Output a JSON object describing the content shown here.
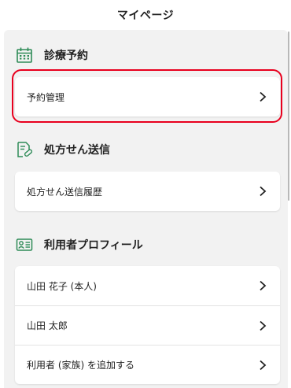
{
  "header": {
    "title": "マイページ"
  },
  "sections": [
    {
      "title": "診療予約",
      "icon": "calendar-icon",
      "items": [
        {
          "label": "予約管理"
        }
      ]
    },
    {
      "title": "処方せん送信",
      "icon": "prescription-icon",
      "items": [
        {
          "label": "処方せん送信履歴"
        }
      ]
    },
    {
      "title": "利用者プロフィール",
      "icon": "profile-card-icon",
      "items": [
        {
          "label": "山田 花子 (本人)"
        },
        {
          "label": "山田 太郎"
        },
        {
          "label": "利用者 (家族) を追加する"
        }
      ]
    }
  ],
  "colors": {
    "accent_green": "#2e8b57",
    "highlight_red": "#e8001e",
    "background": "#f2f2f2"
  }
}
